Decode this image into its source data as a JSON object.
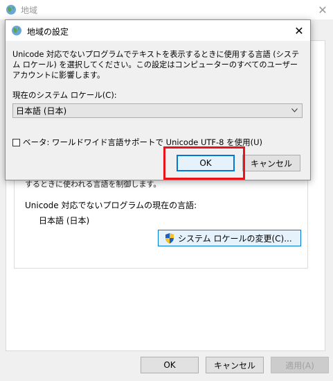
{
  "background_window": {
    "title": "地域",
    "partial_text": "するときに使われる言語を制御します。",
    "current_language_label": "Unicode 対応でないプログラムの現在の言語:",
    "current_language_value": "日本語 (日本)",
    "change_locale_button": "システム ロケールの変更(C)...",
    "ok_button": "OK",
    "cancel_button": "キャンセル",
    "apply_button": "適用(A)"
  },
  "dialog": {
    "title": "地域の設定",
    "description": "Unicode 対応でないプログラムでテキストを表示するときに使用する言語 (システム ロケール) を選択してください。この設定はコンピューターのすべてのユーザー アカウントに影響します。",
    "locale_label": "現在のシステム ロケール(C):",
    "locale_value": "日本語 (日本)",
    "beta_checkbox_label": "ベータ: ワールドワイド言語サポートで Unicode UTF-8 を使用(U)",
    "beta_checked": false,
    "ok_button": "OK",
    "cancel_button": "キャンセル"
  },
  "colors": {
    "accent": "#0078d7",
    "highlight": "#e8141c"
  },
  "icons": {
    "window": "globe-icon",
    "close": "close-icon",
    "uac": "shield-icon",
    "dropdown": "chevron-down-icon"
  }
}
